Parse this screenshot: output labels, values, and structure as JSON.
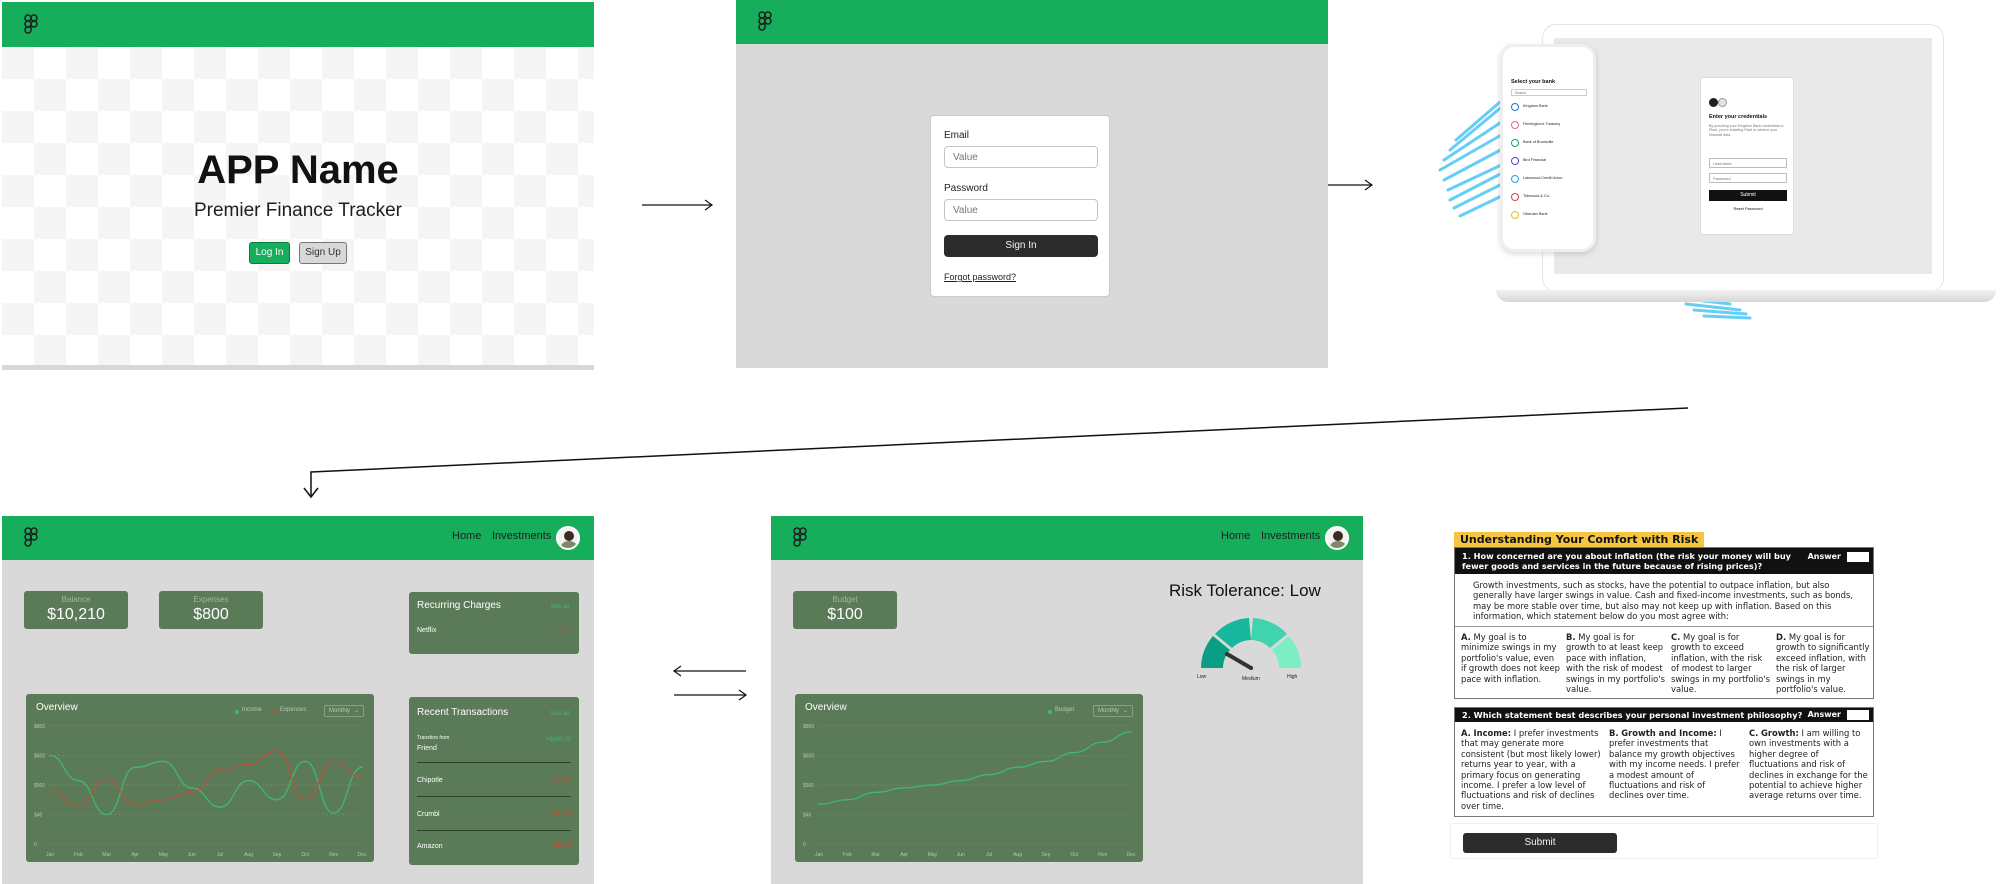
{
  "landing": {
    "app_name": "APP Name",
    "tagline": "Premier Finance Tracker",
    "login_label": "Log In",
    "signup_label": "Sign Up"
  },
  "signin": {
    "email_label": "Email",
    "email_placeholder": "Value",
    "password_label": "Password",
    "password_placeholder": "Value",
    "submit_label": "Sign In",
    "forgot_label": "Forgot password?"
  },
  "bank_link": {
    "phone_title": "Select your bank",
    "phone_search_placeholder": "Search",
    "banks": [
      "Kingdom Bank",
      "Flemington's Treasury",
      "Bank of Brunsville",
      "Bird Financial",
      "Lakewood Credit Union",
      "Tidewood & Co.",
      "Oberdan Bank"
    ],
    "modal_title": "Enter your credentials",
    "modal_body": "By providing your Kingdom Bank credentials to Plaid, you're enabling Plaid to retrieve your financial data.",
    "username_placeholder": "Username",
    "password_placeholder": "Password",
    "submit_label": "Submit",
    "reset_label": "Reset Password"
  },
  "nav": {
    "home": "Home",
    "investments": "Investments"
  },
  "dashboard": {
    "balance_label": "Balance",
    "balance_value": "$10,210",
    "expenses_label": "Expenses",
    "expenses_value": "$800",
    "recurring_title": "Recurring Charges",
    "recurring_see_all": "See all",
    "recurring_items": [
      {
        "name": "Netflix",
        "amount": "-$15"
      }
    ],
    "overview_title": "Overview",
    "legend_income": "Income",
    "legend_expenses": "Expenses",
    "period_select": "Monthly",
    "transactions_title": "Recent Transactions",
    "transactions_see_all": "See all",
    "transactions_sub": "Transfers from",
    "transactions": [
      {
        "name": "Friend",
        "amount": "+$100.00"
      },
      {
        "name": "Chipotle",
        "amount": "-$12.00"
      },
      {
        "name": "Crumbl",
        "amount": "-$24.00"
      },
      {
        "name": "Amazon",
        "amount": "-$56.00"
      }
    ]
  },
  "investments_page": {
    "budget_label": "Budget",
    "budget_value": "$100",
    "risk_title": "Risk Tolerance: Low",
    "gauge_low": "Low",
    "gauge_medium": "Medium",
    "gauge_high": "High",
    "overview_title": "Overview",
    "legend_budget": "Budget",
    "period_select": "Monthly"
  },
  "quiz": {
    "banner": "Understanding Your Comfort with Risk",
    "q1_title": "1. How concerned are you about inflation (the risk your money will buy fewer goods and services in the future because of rising prices)?",
    "answer_label": "Answer",
    "q1_intro": "Growth investments, such as stocks, have the potential to outpace inflation, but also generally have larger swings in value. Cash and fixed-income investments, such as bonds, may be more stable over time, but also may not keep up with inflation. Based on this information, which statement below do you most agree with:",
    "q1_options": [
      {
        "letter": "A.",
        "text": "My goal is to minimize swings in my portfolio's value, even if growth does not keep pace with inflation."
      },
      {
        "letter": "B.",
        "text": "My goal is for growth to at least keep pace with inflation, with the risk of modest swings in my portfolio's value."
      },
      {
        "letter": "C.",
        "text": "My goal is for growth to exceed inflation, with the risk of modest to larger swings in my portfolio's value."
      },
      {
        "letter": "D.",
        "text": "My goal is for growth to significantly exceed inflation, with the risk of larger swings in my portfolio's value."
      }
    ],
    "q2_title": "2. Which statement best describes your personal investment philosophy?",
    "q2_options": [
      {
        "letter": "A.",
        "head": "Income:",
        "text": "I prefer investments that may generate more consistent (but most likely lower) returns year to year, with a primary focus on generating income. I prefer a low level of fluctuations and risk of declines over time."
      },
      {
        "letter": "B.",
        "head": "Growth and Income:",
        "text": "I prefer investments that balance my growth objectives with my income needs. I prefer a modest amount of fluctuations and risk of declines over time."
      },
      {
        "letter": "C.",
        "head": "Growth:",
        "text": "I am willing to own investments with a higher degree of fluctuations and risk of declines in exchange for the potential to achieve higher average returns over time."
      }
    ],
    "submit_label": "Submit"
  },
  "chart_data": [
    {
      "type": "line",
      "title": "Overview",
      "categories": [
        "Jan",
        "Feb",
        "Mar",
        "Apr",
        "May",
        "Jun",
        "Jul",
        "Aug",
        "Sep",
        "Oct",
        "Nov",
        "Dec"
      ],
      "y_ticks": [
        "0",
        "$40",
        "$500",
        "$600",
        "$800"
      ],
      "series": [
        {
          "name": "Income",
          "color": "#3fb96b",
          "values": [
            600,
            430,
            200,
            520,
            560,
            380,
            250,
            430,
            300,
            560,
            210,
            520
          ]
        },
        {
          "name": "Expenses",
          "color": "#b9533f",
          "values": [
            360,
            260,
            440,
            270,
            300,
            350,
            500,
            540,
            630,
            300,
            560,
            450
          ]
        }
      ]
    },
    {
      "type": "line",
      "title": "Overview",
      "categories": [
        "Jan",
        "Feb",
        "Mar",
        "Apr",
        "May",
        "Jun",
        "Jul",
        "Aug",
        "Sep",
        "Oct",
        "Nov",
        "Dec"
      ],
      "y_ticks": [
        "0",
        "$40",
        "$500",
        "$600",
        "$800"
      ],
      "series": [
        {
          "name": "Budget",
          "color": "#3fb96b",
          "values": [
            270,
            300,
            350,
            380,
            400,
            430,
            470,
            520,
            560,
            620,
            690,
            760
          ]
        }
      ]
    }
  ],
  "gauge": {
    "level": "Low"
  },
  "colors": {
    "brand_green": "#16ae5b",
    "card_green": "#5b7a57",
    "accent_yellow": "#f5c542",
    "plaid_blue": "#56c8f5"
  }
}
